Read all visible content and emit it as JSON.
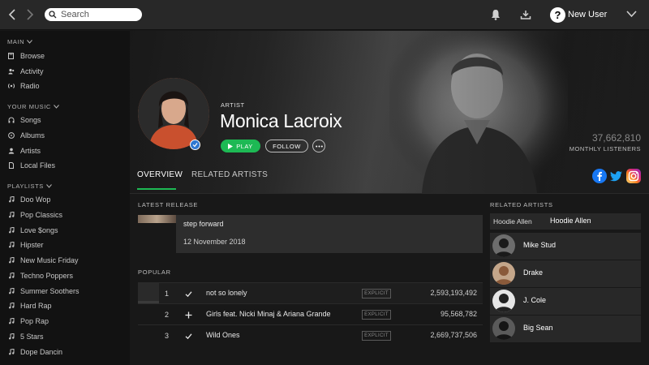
{
  "topbar": {
    "search_placeholder": "Search",
    "user_name": "New User",
    "user_avatar_glyph": "?"
  },
  "sidebar": {
    "main": {
      "heading": "MAIN",
      "items": [
        {
          "label": "Browse",
          "icon": "browse-icon"
        },
        {
          "label": "Activity",
          "icon": "activity-icon"
        },
        {
          "label": "Radio",
          "icon": "radio-icon"
        }
      ]
    },
    "music": {
      "heading": "YOUR MUSIC",
      "items": [
        {
          "label": "Songs",
          "icon": "headphones-icon"
        },
        {
          "label": "Albums",
          "icon": "album-icon"
        },
        {
          "label": "Artists",
          "icon": "artist-icon"
        },
        {
          "label": "Local Files",
          "icon": "file-icon"
        }
      ]
    },
    "playlists": {
      "heading": "PLAYLISTS",
      "items": [
        {
          "label": "Doo Wop"
        },
        {
          "label": "Pop Classics"
        },
        {
          "label": "Love $ongs"
        },
        {
          "label": "Hipster"
        },
        {
          "label": "New Music Friday"
        },
        {
          "label": "Techno Poppers"
        },
        {
          "label": "Summer Soothers"
        },
        {
          "label": "Hard Rap"
        },
        {
          "label": "Pop Rap"
        },
        {
          "label": "5 Stars"
        },
        {
          "label": "Dope Dancin"
        }
      ]
    }
  },
  "artist": {
    "kind": "ARTIST",
    "name": "Monica Lacroix",
    "play_label": "PLAY",
    "follow_label": "FOLLOW",
    "listeners_count": "37,662,810",
    "listeners_label": "MONTHLY LISTENERS"
  },
  "tabs": [
    {
      "label": "OVERVIEW",
      "active": true
    },
    {
      "label": "RELATED ARTISTS",
      "active": false
    }
  ],
  "social": [
    "facebook-icon",
    "twitter-icon",
    "instagram-icon"
  ],
  "latest_release": {
    "heading": "LATEST RELEASE",
    "title": "step forward",
    "date": "12 November 2018"
  },
  "popular": {
    "heading": "POPULAR",
    "tracks": [
      {
        "num": "1",
        "action": "check",
        "title": "not so lonely",
        "badge": "EXPLICIT",
        "plays": "2,593,193,492"
      },
      {
        "num": "2",
        "action": "plus",
        "title": "Girls feat. Nicki Minaj & Ariana Grande",
        "badge": "EXPLICIT",
        "plays": "95,568,782"
      },
      {
        "num": "3",
        "action": "check",
        "title": "Wild Ones",
        "badge": "EXPLICIT",
        "plays": "2,669,737,506"
      }
    ]
  },
  "related": {
    "heading": "RELATED ARTISTS",
    "artists": [
      {
        "name": "Hoodie Allen",
        "alt": "Hoodie Allen"
      },
      {
        "name": "Mike Stud"
      },
      {
        "name": "Drake"
      },
      {
        "name": "J. Cole"
      },
      {
        "name": "Big Sean"
      }
    ]
  },
  "colors": {
    "accent": "#1db954",
    "sidebar_bg": "#121212",
    "topbar_bg": "#282828",
    "content_bg": "#181818"
  }
}
